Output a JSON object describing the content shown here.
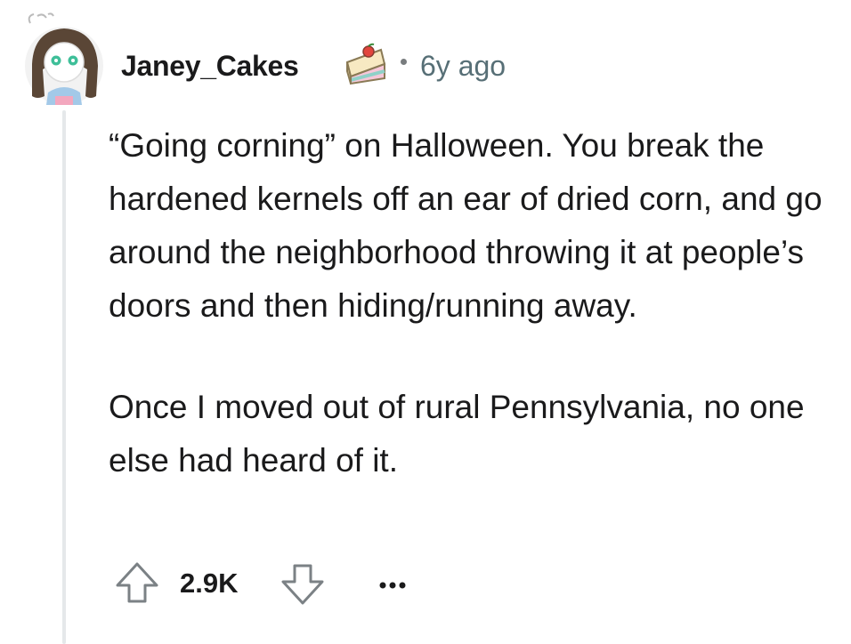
{
  "comment": {
    "author": "Janey_Cakes",
    "flair_icon": "cake-slice-icon",
    "age": "6y ago",
    "paragraphs": [
      "“Going corning” on Halloween. You break the hardened kernels off an ear of dried corn, and go around the neighborhood throwing it at people’s doors and then hiding/running away.",
      "Once I moved out of rural Pennsylvania, no one else had heard of it."
    ],
    "score": "2.9K"
  },
  "actions": {
    "upvote_icon": "arrow-up-icon",
    "downvote_icon": "arrow-down-icon",
    "more_icon": "ellipsis-icon"
  },
  "colors": {
    "text": "#1a1a1b",
    "meta": "#576f76",
    "thread_line": "#e5e8ea"
  }
}
